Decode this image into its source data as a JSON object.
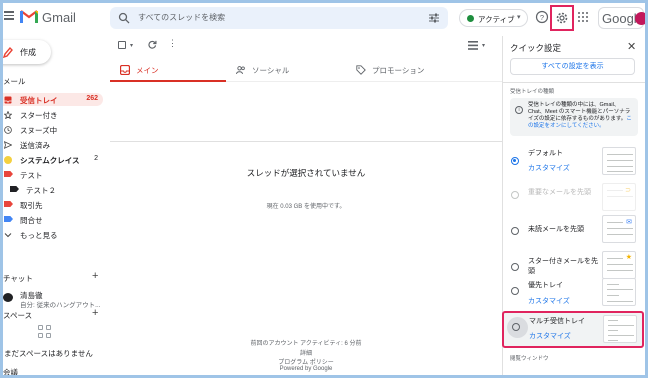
{
  "header": {
    "app_name": "Gmail",
    "search_placeholder": "すべてのスレッドを検索",
    "status_label": "アクティブ",
    "brand": "Google"
  },
  "sidebar": {
    "compose_label": "作成",
    "mail_section": "メール",
    "items": [
      {
        "label": "受信トレイ",
        "count": "262",
        "icon": "inbox-icon",
        "active": true
      },
      {
        "label": "スター付き",
        "count": "",
        "icon": "star-icon"
      },
      {
        "label": "スヌーズ中",
        "count": "",
        "icon": "clock-icon"
      },
      {
        "label": "送信済み",
        "count": "",
        "icon": "send-icon"
      },
      {
        "label": "システムクレイス",
        "count": "2",
        "icon": "label-icon",
        "bold": true,
        "color": "#f4d03f"
      },
      {
        "label": "テスト",
        "count": "",
        "icon": "label-icon",
        "color": "#e8453c"
      },
      {
        "label": "テスト２",
        "count": "",
        "icon": "label-icon",
        "color": "#202124"
      },
      {
        "label": "取引先",
        "count": "",
        "icon": "label-icon",
        "color": "#e8453c"
      },
      {
        "label": "問合せ",
        "count": "",
        "icon": "label-icon",
        "color": "#4285f4"
      },
      {
        "label": "もっと見る",
        "count": "",
        "icon": "chevron-down-icon"
      }
    ],
    "chat_section": "チャット",
    "chat_person": "清島徹",
    "chat_status": "自分: 従来のハングアウト...",
    "spaces_section": "スペース",
    "spaces_empty": "まだスペースはありません",
    "meet_section": "会議"
  },
  "main": {
    "tabs": [
      {
        "label": "メイン",
        "icon": "inbox-tab-icon",
        "active": true
      },
      {
        "label": "ソーシャル",
        "icon": "people-icon"
      },
      {
        "label": "プロモーション",
        "icon": "tag-icon"
      }
    ],
    "empty_message": "スレッドが選択されていません",
    "usage": "現在 0.03 GB を使用中です。",
    "last_activity": "前回のアカウント アクティビティ: 6 分前",
    "details_link": "詳細",
    "program_policy": "プログラム ポリシー",
    "powered_by": "Powered by Google"
  },
  "quick_settings": {
    "title": "クイック設定",
    "all_settings": "すべての設定を表示",
    "inbox_type_label": "受信トレイの種類",
    "info_text": "受信トレイの種類の中には、Gmail、Chat、Meet のスマート機能とパーソナライズの設定に依存するものがあります。",
    "info_link": "この設定をオンにしてください。",
    "options": [
      {
        "label": "デフォルト",
        "customize": "カスタマイズ",
        "selected": true
      },
      {
        "label": "重要なメールを先頭",
        "disabled": true
      },
      {
        "label": "未読メールを先頭"
      },
      {
        "label": "スター付きメールを先頭"
      },
      {
        "label": "優先トレイ",
        "customize": "カスタマイズ"
      },
      {
        "label": "マルチ受信トレイ",
        "customize": "カスタマイズ"
      }
    ],
    "reading_pane_label": "閲覧ウィンドウ"
  },
  "colors": {
    "accent_red": "#d93025",
    "highlight": "#e0245e",
    "link_blue": "#1a73e8"
  }
}
